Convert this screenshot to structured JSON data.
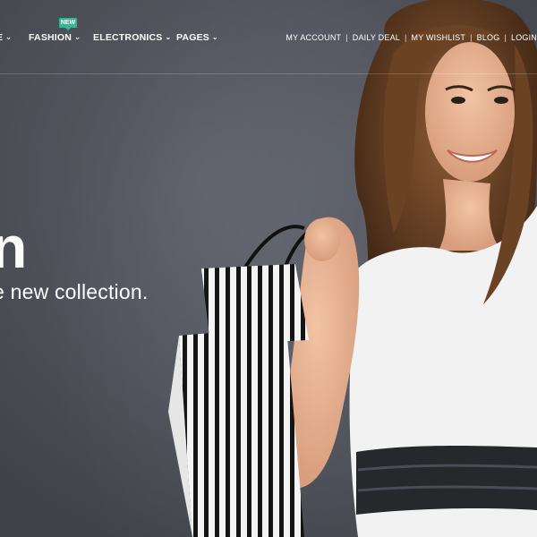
{
  "nav": {
    "menu": [
      {
        "label": "E"
      },
      {
        "label": "FASHION",
        "badge": "NEW"
      },
      {
        "label": "ELECTRONICS"
      },
      {
        "label": "PAGES"
      }
    ],
    "chevron_icon": "chevron-down-icon",
    "top_links": [
      "MY ACCOUNT",
      "DAILY DEAL",
      "MY WISHLIST",
      "BLOG",
      "LOGIN"
    ],
    "separator": "|"
  },
  "hero": {
    "title": "n",
    "subtitle": "e new collection."
  },
  "colors": {
    "background": "#5b5e67",
    "badge": "#2fb795",
    "text": "#ffffff"
  }
}
